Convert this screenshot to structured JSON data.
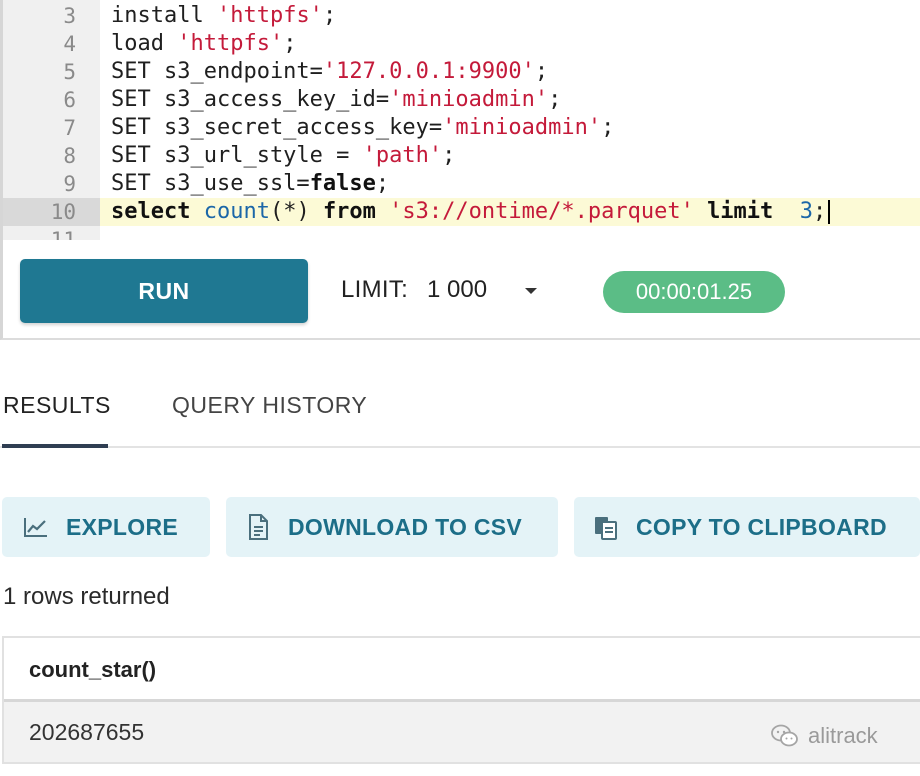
{
  "editor": {
    "lines": [
      {
        "n": "3",
        "tokens": [
          {
            "t": "install ",
            "c": "plain"
          },
          {
            "t": "'httpfs'",
            "c": "str"
          },
          {
            "t": ";",
            "c": "plain"
          }
        ]
      },
      {
        "n": "4",
        "tokens": [
          {
            "t": "load ",
            "c": "plain"
          },
          {
            "t": "'httpfs'",
            "c": "str"
          },
          {
            "t": ";",
            "c": "plain"
          }
        ]
      },
      {
        "n": "5",
        "tokens": [
          {
            "t": "SET s3_endpoint=",
            "c": "plain"
          },
          {
            "t": "'127.0.0.1:9900'",
            "c": "str"
          },
          {
            "t": ";",
            "c": "plain"
          }
        ]
      },
      {
        "n": "6",
        "tokens": [
          {
            "t": "SET s3_access_key_id=",
            "c": "plain"
          },
          {
            "t": "'minioadmin'",
            "c": "str"
          },
          {
            "t": ";",
            "c": "plain"
          }
        ]
      },
      {
        "n": "7",
        "tokens": [
          {
            "t": "SET s3_secret_access_key=",
            "c": "plain"
          },
          {
            "t": "'minioadmin'",
            "c": "str"
          },
          {
            "t": ";",
            "c": "plain"
          }
        ]
      },
      {
        "n": "8",
        "tokens": [
          {
            "t": "SET s3_url_style = ",
            "c": "plain"
          },
          {
            "t": "'path'",
            "c": "str"
          },
          {
            "t": ";",
            "c": "plain"
          }
        ]
      },
      {
        "n": "9",
        "tokens": [
          {
            "t": "SET s3_use_ssl=",
            "c": "plain"
          },
          {
            "t": "false",
            "c": "kw"
          },
          {
            "t": ";",
            "c": "plain"
          }
        ]
      },
      {
        "n": "10",
        "active": true,
        "tokens": [
          {
            "t": "select ",
            "c": "kw"
          },
          {
            "t": "count",
            "c": "fn"
          },
          {
            "t": "(*) ",
            "c": "plain"
          },
          {
            "t": "from ",
            "c": "kw"
          },
          {
            "t": "'s3://ontime/*.parquet'",
            "c": "str"
          },
          {
            "t": " ",
            "c": "plain"
          },
          {
            "t": "limit",
            "c": "kw"
          },
          {
            "t": "  ",
            "c": "plain"
          },
          {
            "t": "3",
            "c": "fn"
          },
          {
            "t": ";",
            "c": "plain"
          }
        ]
      },
      {
        "n": "11",
        "tokens": []
      }
    ]
  },
  "runbar": {
    "run_label": "RUN",
    "limit_label": "LIMIT:",
    "limit_value": "1 000",
    "timer": "00:00:01.25"
  },
  "tabs": {
    "results": "RESULTS",
    "history": "QUERY HISTORY"
  },
  "actions": {
    "explore": "EXPLORE",
    "csv": "DOWNLOAD TO CSV",
    "clipboard": "COPY TO CLIPBOARD"
  },
  "results": {
    "summary": "1 rows returned",
    "columns": [
      "count_star()"
    ],
    "rows": [
      [
        "202687655"
      ]
    ]
  },
  "watermark": {
    "text": "alitrack"
  },
  "colors": {
    "run_button": "#1f7892",
    "timer_badge": "#5bbd86",
    "action_bg": "#e4f3f7",
    "action_text": "#1c6e88",
    "string": "#c41a3a",
    "function": "#1c67a8"
  },
  "icons": {
    "explore": "chart-line-icon",
    "csv": "document-icon",
    "clipboard": "clipboard-icon",
    "limit": "caret-down-icon",
    "watermark": "wechat-icon"
  }
}
